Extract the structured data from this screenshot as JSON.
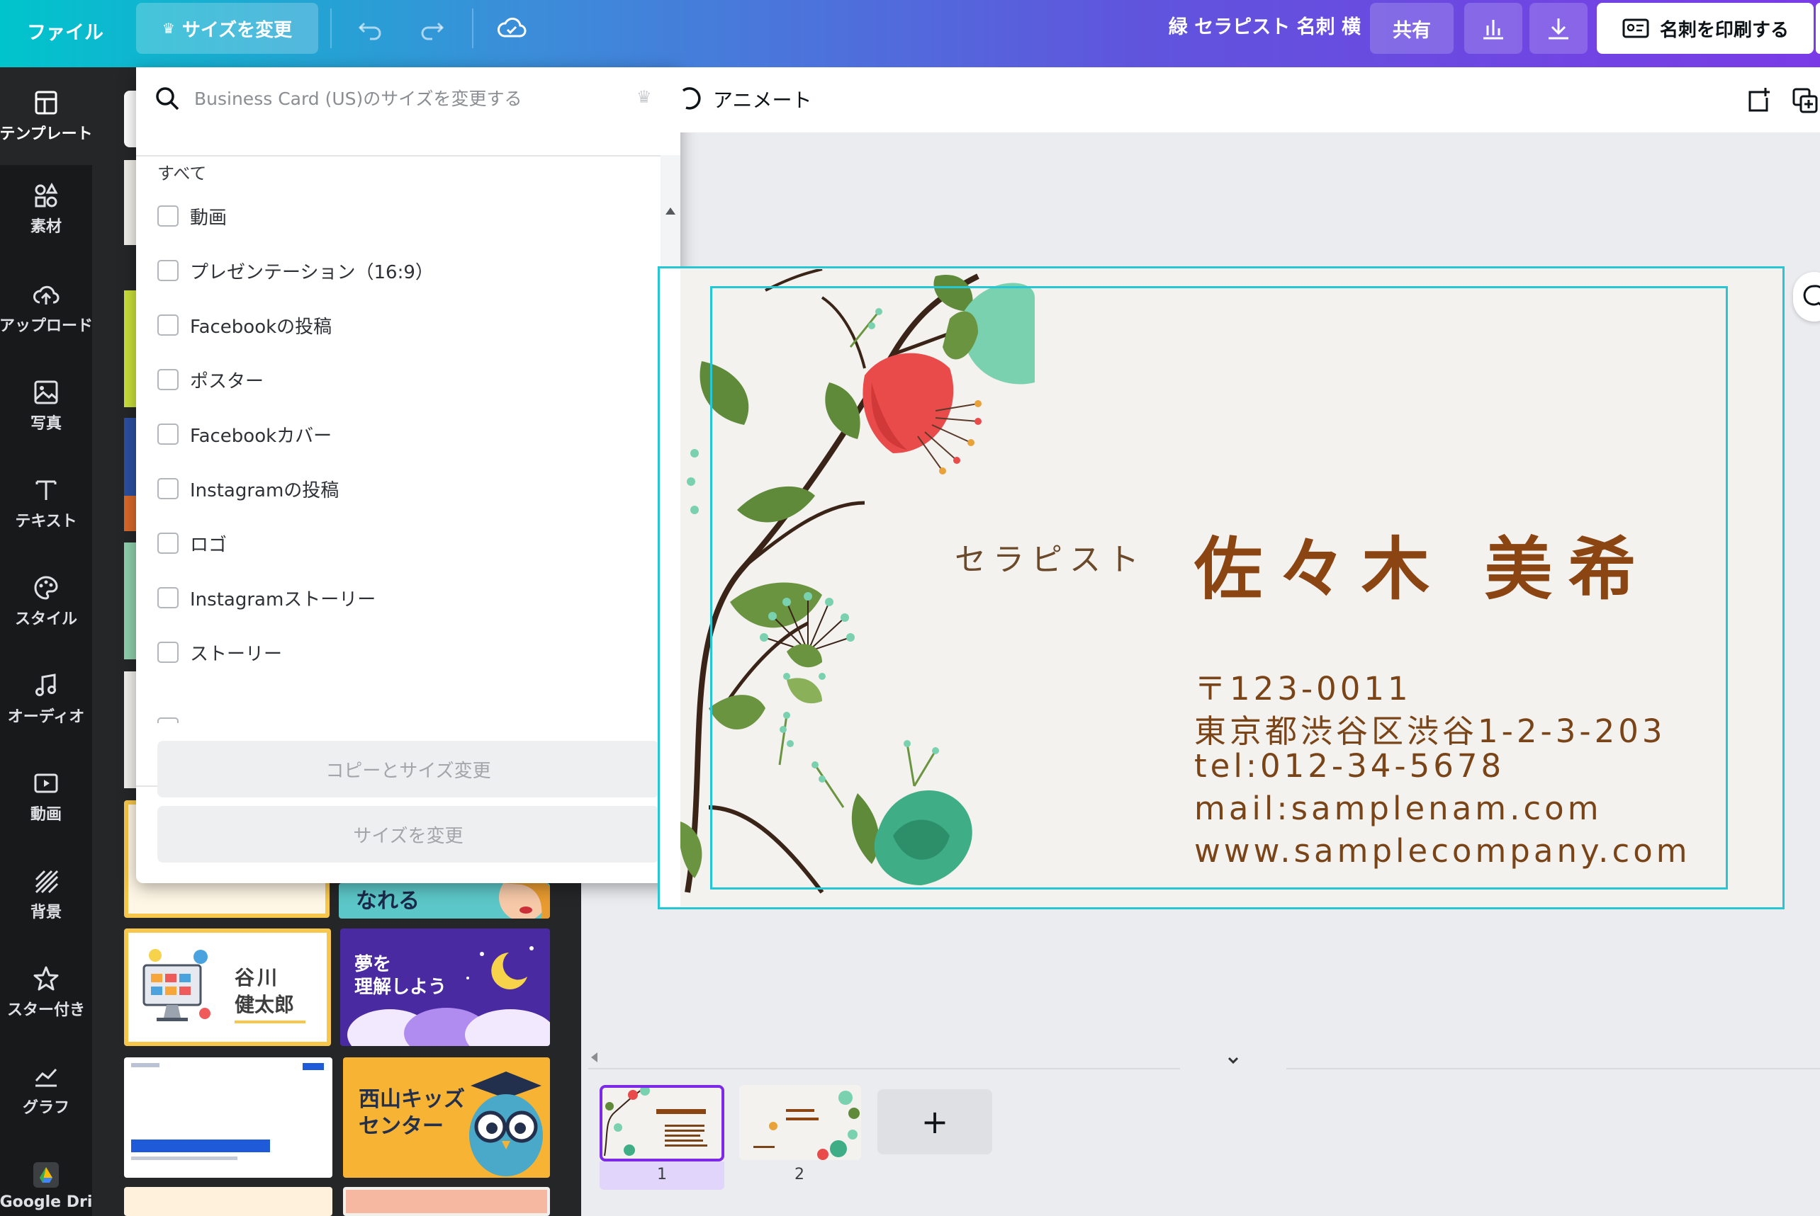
{
  "topbar": {
    "file_label": "ファイル",
    "resize_label": "サイズを変更",
    "design_title": "緑 セラピスト 名刺 横",
    "share_label": "共有",
    "print_label": "名刺を印刷する",
    "colors": {
      "gradient_start": "#00c4cc",
      "gradient_end": "#7a3be6"
    }
  },
  "sidebar": {
    "items": [
      {
        "label": "テンプレート",
        "icon": "template-icon"
      },
      {
        "label": "素材",
        "icon": "elements-icon"
      },
      {
        "label": "アップロード",
        "icon": "upload-icon"
      },
      {
        "label": "写真",
        "icon": "photo-icon"
      },
      {
        "label": "テキスト",
        "icon": "text-icon"
      },
      {
        "label": "スタイル",
        "icon": "palette-icon"
      },
      {
        "label": "オーディオ",
        "icon": "music-icon"
      },
      {
        "label": "動画",
        "icon": "video-icon"
      },
      {
        "label": "背景",
        "icon": "background-icon"
      },
      {
        "label": "スター付き",
        "icon": "star-icon"
      },
      {
        "label": "グラフ",
        "icon": "chart-icon"
      },
      {
        "label": "Google Dri",
        "icon": "google-drive-icon"
      }
    ]
  },
  "templates": {
    "cards": [
      {
        "text1": "谷川",
        "text2": "健太郎"
      },
      {
        "text1": "夢を",
        "text2": "理解しよう"
      },
      {
        "text1": "西山キッズ",
        "text2": "センター"
      },
      {
        "text1": "なれる",
        "text2": ""
      }
    ]
  },
  "resize_dropdown": {
    "search_placeholder": "Business Card (US)のサイズを変更する",
    "section_label": "すべて",
    "options": [
      "動画",
      "プレゼンテーション（16:9）",
      "Facebookの投稿",
      "ポスター",
      "Facebookカバー",
      "Instagramの投稿",
      "ロゴ",
      "Instagramストーリー",
      "ストーリー"
    ],
    "copy_resize_label": "コピーとサイズ変更",
    "resize_label": "サイズを変更"
  },
  "canvas": {
    "animate_label": "アニメート",
    "card": {
      "role": "セラピスト",
      "name": "佐々木 美希",
      "postal": "〒123-0011",
      "address": "東京都渋谷区渋谷1-2-3-203",
      "tel": "tel:012-34-5678",
      "mail": "mail:samplenam.com",
      "web": "www.samplecompany.com",
      "colors": {
        "name": "#8b4513",
        "text": "#7a4419",
        "selection": "#26c7d4"
      }
    }
  },
  "pages": {
    "items": [
      {
        "number": "1"
      },
      {
        "number": "2"
      }
    ],
    "add_label": "+"
  }
}
